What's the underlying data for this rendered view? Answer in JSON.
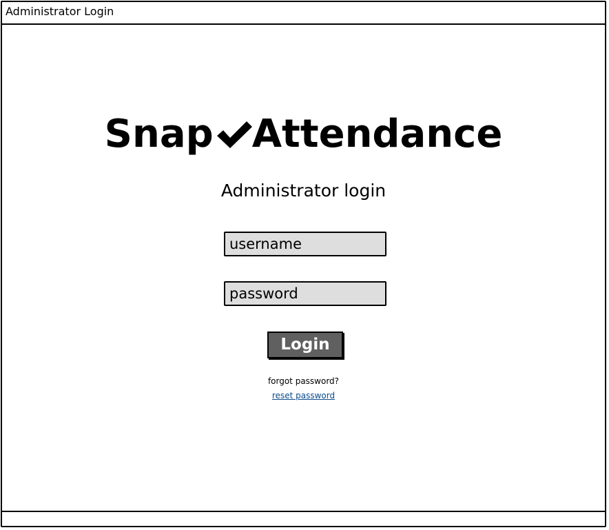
{
  "window": {
    "title": "Administrator Login"
  },
  "logo": {
    "part1": "Snap",
    "check_icon": "checkmark-icon",
    "part2": "Attendance"
  },
  "subtitle": "Administrator login",
  "form": {
    "username_placeholder": "username",
    "password_placeholder": "password",
    "login_label": "Login"
  },
  "forgot_text": "forgot password?",
  "reset_link": "reset password",
  "colors": {
    "field_bg": "#dedede",
    "button_bg": "#606060",
    "link": "#0b4a8c"
  }
}
